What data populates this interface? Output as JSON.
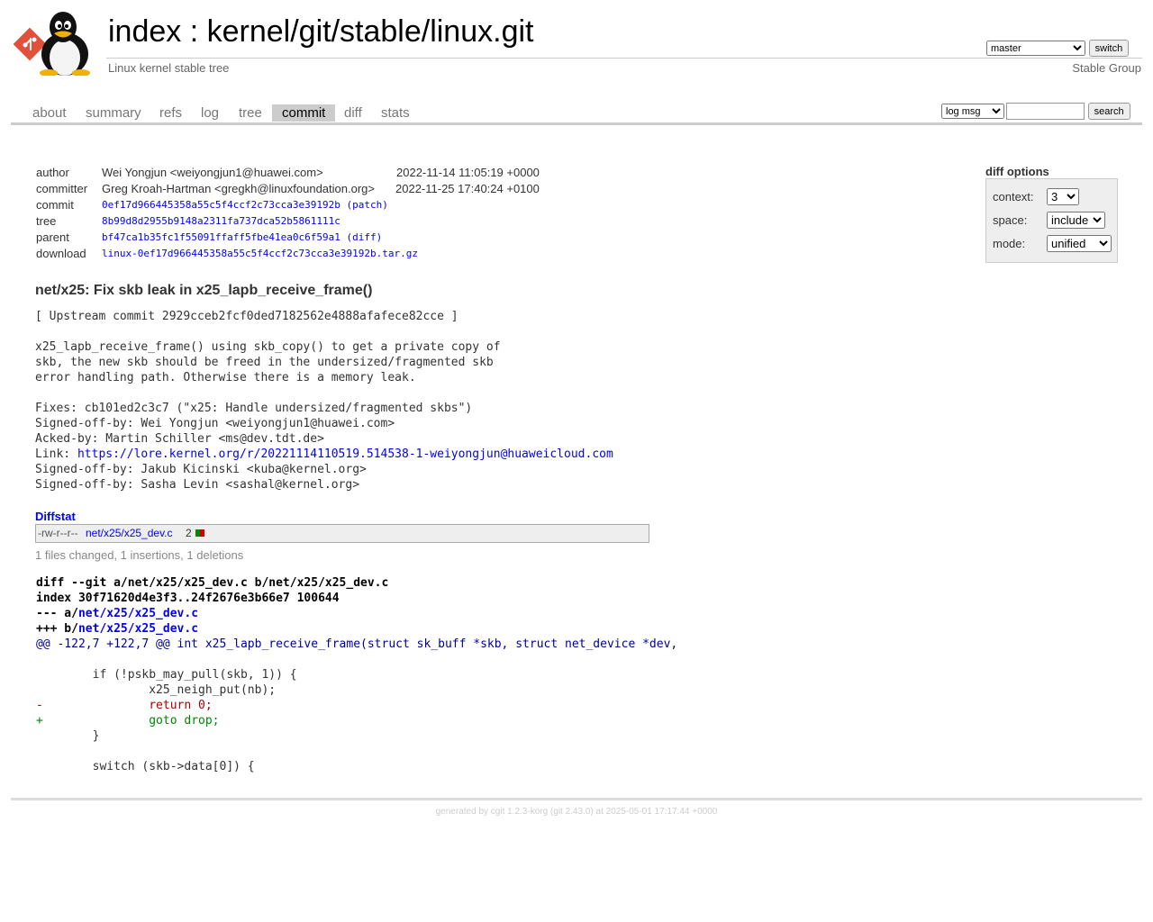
{
  "header": {
    "title_index": "index",
    "title_sep": " : ",
    "title_repo": "kernel/git/stable/linux.git",
    "subtitle": "Linux kernel stable tree",
    "owner": "Stable Group",
    "branch_selected": "master",
    "switch_label": "switch"
  },
  "tabs": [
    {
      "label": "about"
    },
    {
      "label": "summary"
    },
    {
      "label": "refs"
    },
    {
      "label": "log"
    },
    {
      "label": "tree"
    },
    {
      "label": "commit"
    },
    {
      "label": "diff"
    },
    {
      "label": "stats"
    }
  ],
  "active_tab": "commit",
  "search": {
    "scope_selected": "log msg",
    "query": "",
    "button_label": "search"
  },
  "commit_info": {
    "author_label": "author",
    "author": "Wei Yongjun <weiyongjun1@huawei.com>",
    "author_date": "2022-11-14 11:05:19 +0000",
    "committer_label": "committer",
    "committer": "Greg Kroah-Hartman <gregkh@linuxfoundation.org>",
    "committer_date": "2022-11-25 17:40:24 +0100",
    "commit_label": "commit",
    "commit_hash": "0ef17d966445358a55c5f4ccf2c73cca3e39192b",
    "patch_link": "patch",
    "tree_label": "tree",
    "tree_hash": "8b99d8d2955b9148a2311fa737dca52b5861111c",
    "parent_label": "parent",
    "parent_hash": "bf47ca1b35fc1f55091ffaff5fbe41ea0c6f59a1",
    "diff_link": "diff",
    "download_label": "download",
    "download_file": "linux-0ef17d966445358a55c5f4ccf2c73cca3e39192b.tar.gz"
  },
  "diff_options": {
    "title": "diff options",
    "context_label": "context:",
    "context_value": "3",
    "space_label": "space:",
    "space_value": "include",
    "mode_label": "mode:",
    "mode_value": "unified"
  },
  "commit_message": {
    "subject": "net/x25: Fix skb leak in x25_lapb_receive_frame()",
    "upstream": "[ Upstream commit 2929cceb2fcf0ded7182562e4888afafece82cce ]",
    "body_lines": [
      "x25_lapb_receive_frame() using skb_copy() to get a private copy of",
      "skb, the new skb should be freed in the undersized/fragmented skb",
      "error handling path. Otherwise there is a memory leak."
    ],
    "fixes": "Fixes: cb101ed2c3c7 (\"x25: Handle undersized/fragmented skbs\")",
    "signed1": "Signed-off-by: Wei Yongjun <weiyongjun1@huawei.com>",
    "acked": "Acked-by: Martin Schiller <ms@dev.tdt.de>",
    "link_prefix": "Link: ",
    "link_url": "https://lore.kernel.org/r/20221114110519.514538-1-weiyongjun@huaweicloud.com",
    "signed2": "Signed-off-by: Jakub Kicinski <kuba@kernel.org>",
    "signed3": "Signed-off-by: Sasha Levin <sashal@kernel.org>"
  },
  "diffstat": {
    "header": "Diffstat",
    "mode": "-rw-r--r--",
    "file": "net/x25/x25_dev.c",
    "count": "2",
    "insertions": 1,
    "deletions": 1,
    "summary": "1 files changed, 1 insertions, 1 deletions"
  },
  "diff": {
    "git_line": "diff --git a/net/x25/x25_dev.c b/net/x25/x25_dev.c",
    "index_line": "index 30f71620d4e3f3..24f2676e3b66e7 100644",
    "minus_prefix": "--- a/",
    "minus_file": "net/x25/x25_dev.c",
    "plus_prefix": "+++ b/",
    "plus_file": "net/x25/x25_dev.c",
    "hunk": "@@ -122,7 +122,7 @@ int x25_lapb_receive_frame(struct sk_buff *skb, struct net_device *dev,",
    "lines": [
      {
        "type": "blank",
        "text": ""
      },
      {
        "type": "ctx",
        "text": " \tif (!pskb_may_pull(skb, 1)) {"
      },
      {
        "type": "ctx",
        "text": " \t\tx25_neigh_put(nb);"
      },
      {
        "type": "del",
        "text": "-\t\treturn 0;"
      },
      {
        "type": "add",
        "text": "+\t\tgoto drop;"
      },
      {
        "type": "ctx",
        "text": " \t}"
      },
      {
        "type": "blank",
        "text": ""
      },
      {
        "type": "ctx",
        "text": " \tswitch (skb->data[0]) {"
      }
    ]
  },
  "footer": "generated by cgit 1.2.3-korg (git 2.43.0) at 2025-05-01 17:17:44 +0000"
}
